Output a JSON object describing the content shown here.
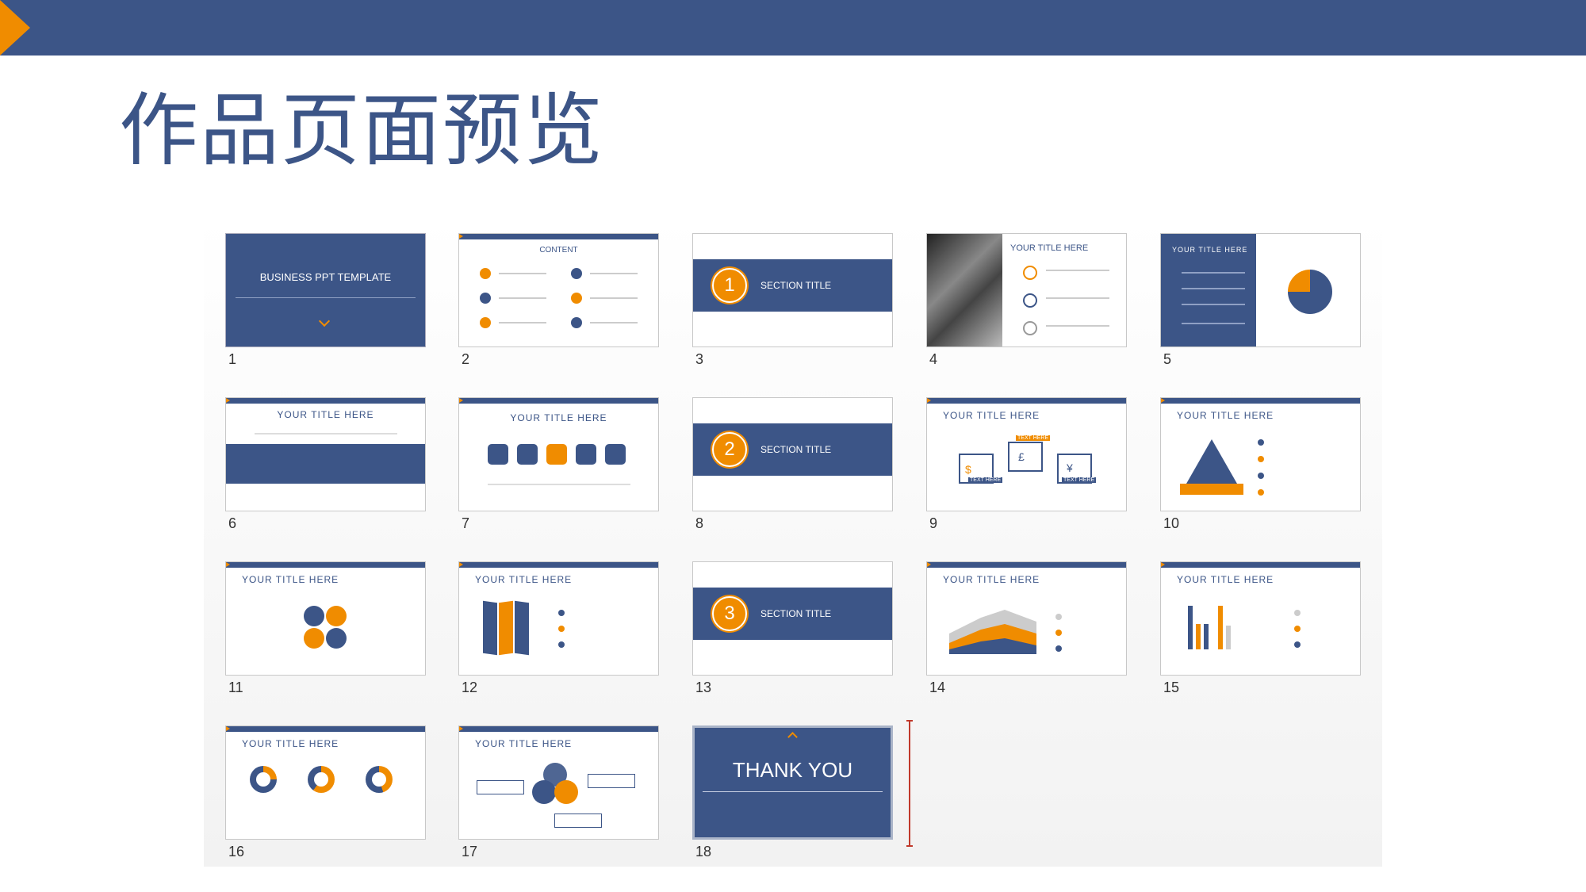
{
  "page": {
    "title": "作品页面预览"
  },
  "colors": {
    "primary": "#3c5587",
    "accent": "#f08c00"
  },
  "slides": [
    {
      "number": "1",
      "title": "BUSINESS PPT TEMPLATE"
    },
    {
      "number": "2",
      "title": "CONTENT"
    },
    {
      "number": "3",
      "title": "SECTION TITLE",
      "badge": "1"
    },
    {
      "number": "4",
      "title": "YOUR TITLE HERE"
    },
    {
      "number": "5",
      "title": "YOUR TITLE HERE"
    },
    {
      "number": "6",
      "title": "YOUR TITLE HERE"
    },
    {
      "number": "7",
      "title": "YOUR TITLE HERE"
    },
    {
      "number": "8",
      "title": "SECTION TITLE",
      "badge": "2"
    },
    {
      "number": "9",
      "title": "YOUR TITLE HERE"
    },
    {
      "number": "10",
      "title": "YOUR TITLE HERE"
    },
    {
      "number": "11",
      "title": "YOUR TITLE HERE"
    },
    {
      "number": "12",
      "title": "YOUR TITLE HERE"
    },
    {
      "number": "13",
      "title": "SECTION TITLE",
      "badge": "3"
    },
    {
      "number": "14",
      "title": "YOUR TITLE HERE"
    },
    {
      "number": "15",
      "title": "YOUR TITLE HERE"
    },
    {
      "number": "16",
      "title": "YOUR TITLE HERE"
    },
    {
      "number": "17",
      "title": "YOUR TITLE HERE"
    },
    {
      "number": "18",
      "title": "THANK YOU"
    }
  ],
  "slide9": {
    "label_top": "TEXT HERE",
    "label_left": "TEXT HERE",
    "label_right": "TEXT HERE"
  }
}
